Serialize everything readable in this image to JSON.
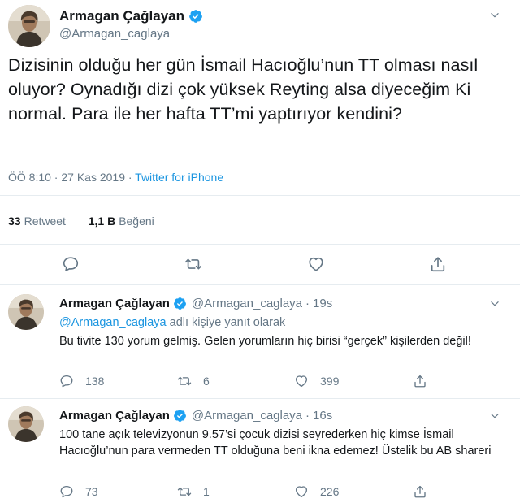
{
  "main_tweet": {
    "display_name": "Armagan Çağlayan",
    "handle": "@Armagan_caglaya",
    "text": "Dizisinin olduğu her gün İsmail Hacıoğlu’nun TT olması nasıl oluyor? Oynadığı dizi çok yüksek Reyting alsa diyeceğim Ki normal. Para ile her hafta TT’mi yaptırıyor kendini?",
    "time": "ÖÖ 8:10 · 27 Kas 2019 ·",
    "source": "Twitter for iPhone",
    "retweet_count": "33",
    "retweet_label": "Retweet",
    "like_count": "1,1 B",
    "like_label": "Beğeni",
    "icons": [
      "reply-icon",
      "retweet-icon",
      "like-icon",
      "share-icon",
      "chevron-down-icon",
      "verified-icon"
    ]
  },
  "replies": [
    {
      "display_name": "Armagan Çağlayan",
      "handle": "@Armagan_caglaya",
      "separator": "·",
      "time": "19s",
      "reply_context_mention": "@Armagan_caglaya",
      "reply_context_suffix": " adlı kişiye yanıt olarak",
      "text": "Bu tivite 130 yorum gelmiş. Gelen yorumların hiç birisi “gerçek” kişilerden değil!",
      "reply_count": "138",
      "retweet_count": "6",
      "like_count": "399"
    },
    {
      "display_name": "Armagan Çağlayan",
      "handle": "@Armagan_caglaya",
      "separator": "·",
      "time": "16s",
      "text": "100 tane açık televizyonun 9.57’si çocuk dizisi seyrederken hiç kimse İsmail Hacıoğlu’nun para vermeden TT olduğuna beni ikna edemez! Üstelik bu AB shareri",
      "reply_count": "73",
      "retweet_count": "1",
      "like_count": "226"
    }
  ],
  "colors": {
    "accent": "#1da1f2",
    "link": "#1b95e0",
    "muted": "#657786",
    "text": "#14171a",
    "divider": "#e6ecf0"
  }
}
